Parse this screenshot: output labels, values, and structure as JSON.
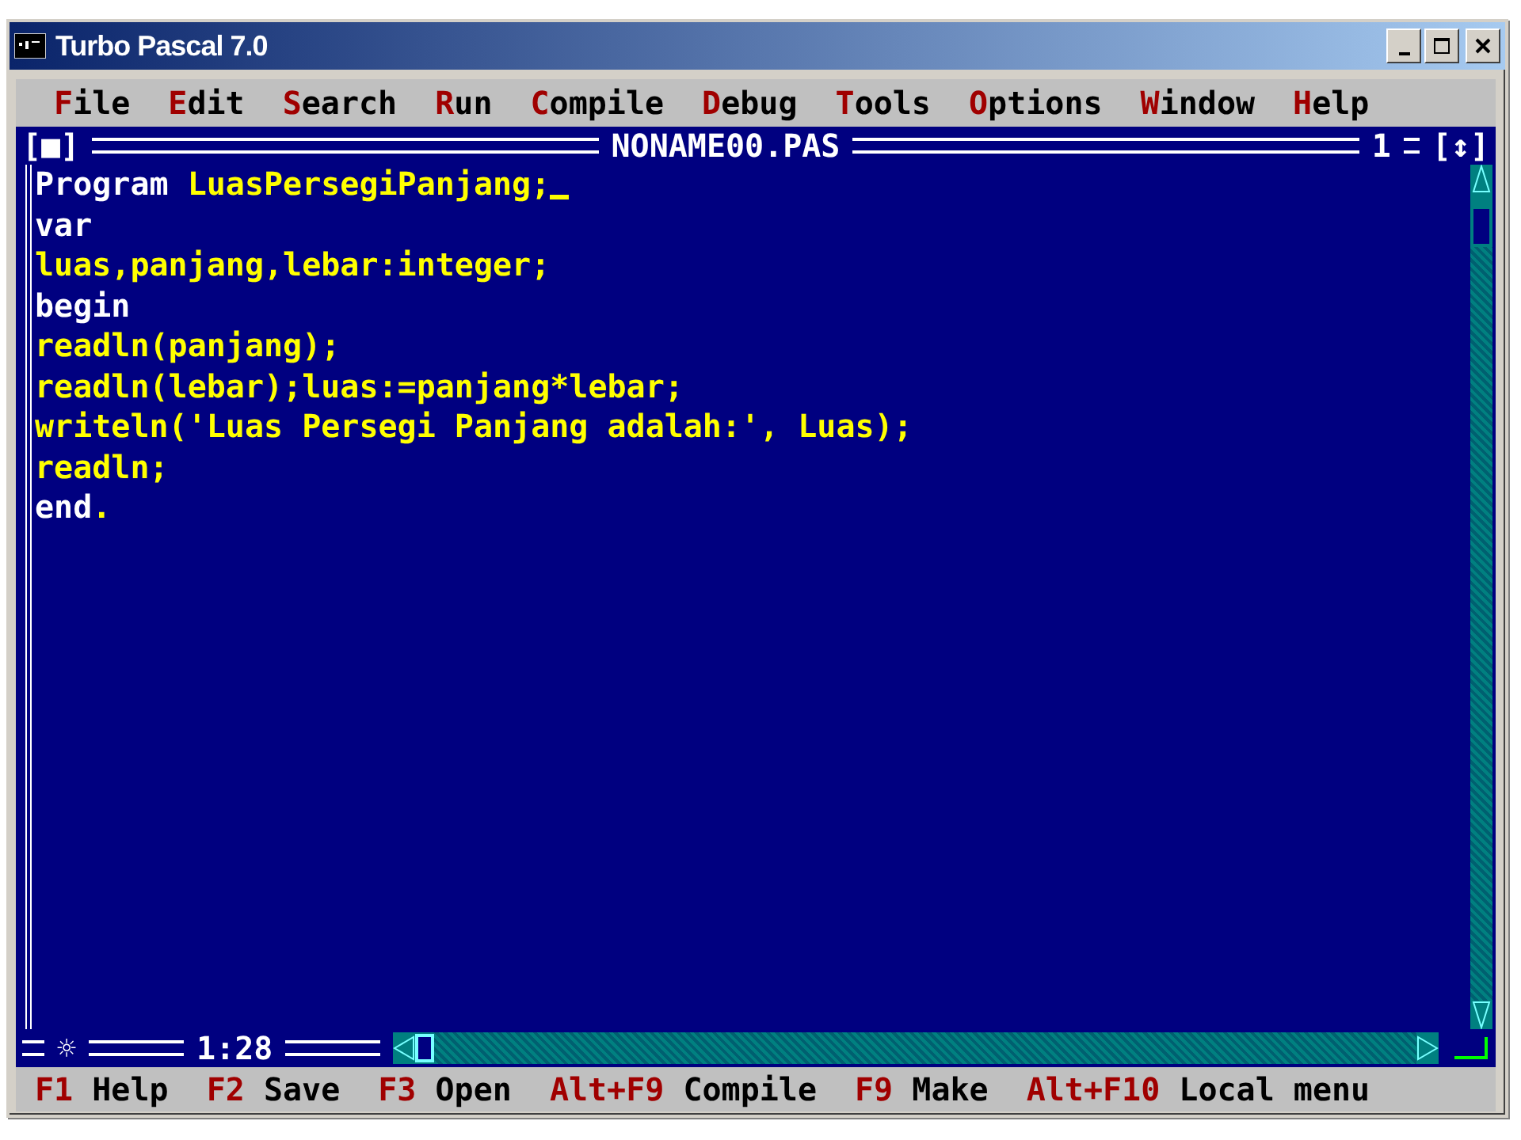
{
  "window": {
    "title": "Turbo Pascal 7.0"
  },
  "menu": [
    {
      "label": "File"
    },
    {
      "label": "Edit"
    },
    {
      "label": "Search"
    },
    {
      "label": "Run"
    },
    {
      "label": "Compile"
    },
    {
      "label": "Debug"
    },
    {
      "label": "Tools"
    },
    {
      "label": "Options"
    },
    {
      "label": "Window"
    },
    {
      "label": "Help"
    }
  ],
  "editor": {
    "title": "NONAME00.PAS",
    "close_box": "[■]",
    "window_number": "1",
    "zoom_box": "[↕]",
    "position": "1:28",
    "modified_mark": "☼",
    "lines": [
      {
        "cursor": true,
        "parts": [
          {
            "kind": "reserved",
            "text": "Program"
          },
          {
            "kind": "plain",
            "text": " LuasPersegiPanjang;"
          }
        ]
      },
      {
        "cursor": false,
        "parts": [
          {
            "kind": "reserved",
            "text": "var"
          }
        ]
      },
      {
        "cursor": false,
        "parts": [
          {
            "kind": "plain",
            "text": "luas,panjang,lebar:integer;"
          }
        ]
      },
      {
        "cursor": false,
        "parts": [
          {
            "kind": "reserved",
            "text": "begin"
          }
        ]
      },
      {
        "cursor": false,
        "parts": [
          {
            "kind": "plain",
            "text": "readln(panjang);"
          }
        ]
      },
      {
        "cursor": false,
        "parts": [
          {
            "kind": "plain",
            "text": "readln(lebar);luas:=panjang*lebar;"
          }
        ]
      },
      {
        "cursor": false,
        "parts": [
          {
            "kind": "plain",
            "text": "writeln('Luas Persegi Panjang adalah:', Luas);"
          }
        ]
      },
      {
        "cursor": false,
        "parts": [
          {
            "kind": "plain",
            "text": "readln;"
          }
        ]
      },
      {
        "cursor": false,
        "parts": [
          {
            "kind": "reserved",
            "text": "end"
          },
          {
            "kind": "plain",
            "text": "."
          }
        ]
      }
    ]
  },
  "status_bar": [
    {
      "key": "F1",
      "label": "Help"
    },
    {
      "key": "F2",
      "label": "Save"
    },
    {
      "key": "F3",
      "label": "Open"
    },
    {
      "key": "Alt+F9",
      "label": "Compile"
    },
    {
      "key": "F9",
      "label": "Make"
    },
    {
      "key": "Alt+F10",
      "label": "Local menu"
    }
  ]
}
